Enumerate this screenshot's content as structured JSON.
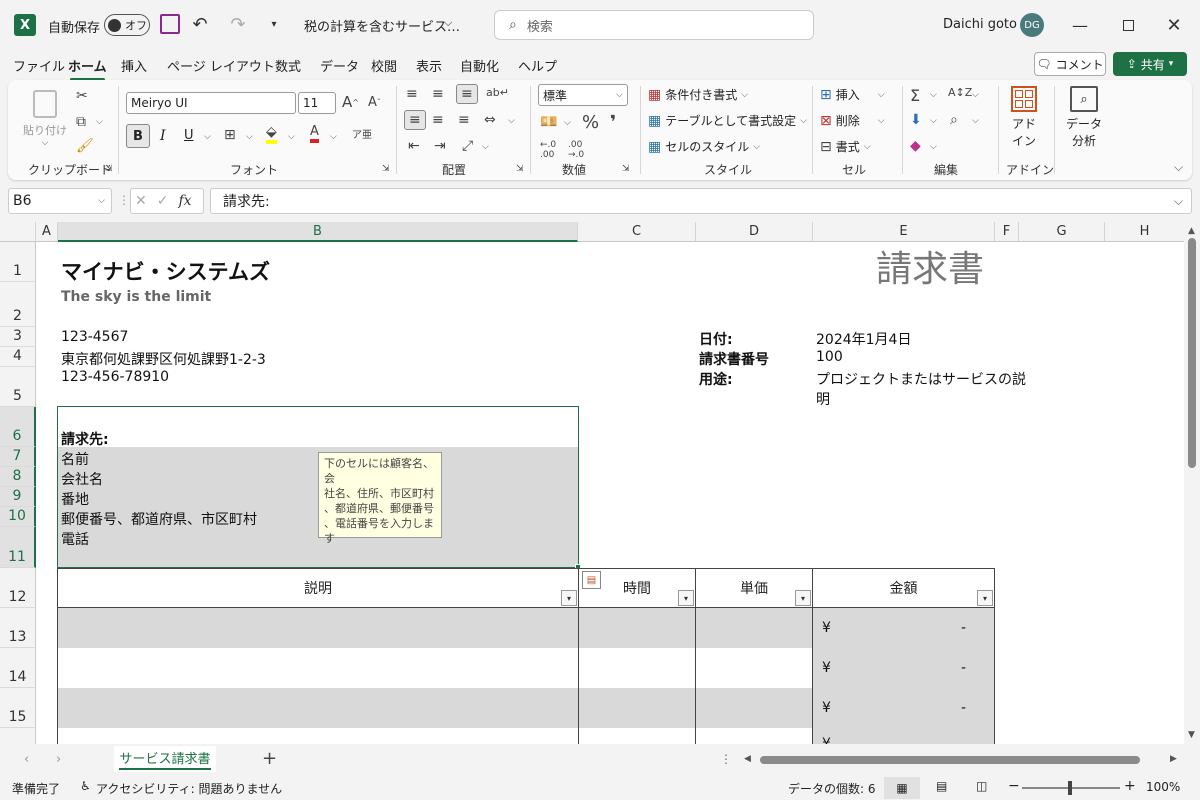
{
  "titlebar": {
    "autosave_label": "自動保存",
    "autosave_state": "オフ",
    "filename": "税の計算を含むサービス…",
    "search_placeholder": "検索",
    "user_name": "Daichi goto",
    "user_initials": "DG"
  },
  "menu": {
    "items": [
      "ファイル",
      "ホーム",
      "挿入",
      "ページ レイアウト",
      "数式",
      "データ",
      "校閲",
      "表示",
      "自動化",
      "ヘルプ"
    ],
    "comment_label": "コメント",
    "share_label": "共有"
  },
  "ribbon": {
    "clipboard": {
      "paste": "貼り付け",
      "label": "クリップボード"
    },
    "font": {
      "name": "Meiryo UI",
      "size": "11",
      "bold": "B",
      "italic": "I",
      "underline": "U",
      "label": "フォント"
    },
    "align": {
      "label": "配置"
    },
    "number": {
      "format": "標準",
      "label": "数値"
    },
    "style": {
      "conditional": "条件付き書式",
      "table": "テーブルとして書式設定",
      "cellstyle": "セルのスタイル",
      "label": "スタイル"
    },
    "cells": {
      "insert": "挿入",
      "delete": "削除",
      "format": "書式",
      "label": "セル"
    },
    "edit": {
      "label": "編集"
    },
    "addin": {
      "addin_line1": "アド",
      "addin_line2": "イン",
      "label": "アドイン"
    },
    "analysis": {
      "line1": "データ",
      "line2": "分析"
    }
  },
  "formula": {
    "namebox": "B6",
    "fx": "fx",
    "content": "請求先:"
  },
  "columns": [
    "A",
    "B",
    "C",
    "D",
    "E",
    "F",
    "G",
    "H"
  ],
  "rows": [
    "1",
    "2",
    "3",
    "4",
    "5",
    "6",
    "7",
    "8",
    "9",
    "10",
    "11",
    "12",
    "13",
    "14",
    "15"
  ],
  "sheet": {
    "company": "マイナビ・システムズ",
    "tagline": "The sky is the limit",
    "invoice_title": "請求書",
    "zip": "123-4567",
    "address": "東京都何処課野区何処課野1-2-3",
    "phone": "123-456-78910",
    "date_label": "日付:",
    "date_value": "2024年1月4日",
    "invno_label": "請求書番号",
    "invno_value": "100",
    "purpose_label": "用途:",
    "purpose_line1": "プロジェクトまたはサービスの説",
    "purpose_line2": "明",
    "billto_label": "請求先:",
    "bill_name": "名前",
    "bill_company": "会社名",
    "bill_street": "番地",
    "bill_city": "郵便番号、都道府県、市区町村",
    "bill_phone": "電話",
    "tooltip": [
      "下のセルには顧客名、会",
      "社名、住所、市区町村",
      "、都道府県、郵便番号",
      "、電話番号を入力しま",
      "す"
    ],
    "th_desc": "説明",
    "th_hours": "時間",
    "th_rate": "単価",
    "th_amount": "金額",
    "yen": "¥",
    "dash": "-"
  },
  "tabs": {
    "sheet_name": "サービス請求書",
    "add": "+"
  },
  "status": {
    "ready": "準備完了",
    "accessibility": "アクセシビリティ: 問題ありません",
    "count": "データの個数: 6",
    "zoom": "100%"
  }
}
